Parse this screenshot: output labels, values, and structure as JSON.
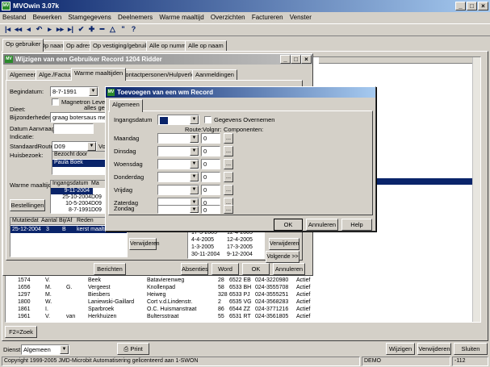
{
  "app": {
    "title": "MVOwin 3.07k"
  },
  "menu": [
    "Bestand",
    "Bewerken",
    "Stamgegevens",
    "Deelnemers",
    "Warme maaltijd",
    "Overzichten",
    "Factureren",
    "Venster"
  ],
  "toolbar_icons": [
    "first-icon",
    "prev-page-icon",
    "prev-icon",
    "undo-icon",
    "next-icon",
    "next-page-icon",
    "last-icon",
    "check-icon",
    "add-icon",
    "delete-icon",
    "up-icon",
    "quote-icon",
    "help-icon"
  ],
  "main_tabs": [
    "Op gebruiker",
    "Op naam",
    "Op adres",
    "Op vestiging/gebruiker",
    "Alle op nummer",
    "Alle op naam"
  ],
  "edit_dialog": {
    "title": "Wijzigen van een Gebruiker Record 1204 Ridder",
    "tabs": [
      "Algemeen",
      "Alge./Factuur",
      "Warme maaltijden",
      "Contactpersonen/Hulpverleners",
      "Aanmeldingen"
    ],
    "begindatum_label": "Begindatum:",
    "begindatum": "8-7-1991",
    "magnetron": "Magnetron Leveren",
    "dieet_label": "Dieet:",
    "alles_gen": "alles gen",
    "bijzonderheden_label": "Bijzonderheden:",
    "bijzonderheden": "graag botersaus met ge",
    "datum_aanvraag_label": "Datum Aanvraag:",
    "indicatie_label": "Indicatie:",
    "standaardroute_label": "StandaardRoute:",
    "standaardroute": "D09",
    "vol": "Vol",
    "huisbezoek_label": "Huisbezoek:",
    "bezocht_door": "Bezocht door",
    "bezocht_naam": "Paula Boek",
    "warme_label": "Warme maaltijd:",
    "warme_headers": [
      "Ingangsdatum",
      "Ma"
    ],
    "warme_rows": [
      [
        "9-11-2004",
        ""
      ],
      [
        "25-10-2004",
        "D09"
      ],
      [
        "10-5-2004",
        "D09"
      ],
      [
        "8-7-1991",
        "D09"
      ]
    ],
    "bestellingen": "Bestellingen",
    "mut_headers": [
      "Mutatiedat",
      "Aantal",
      "Bij/Af",
      "Reden"
    ],
    "mut_rows": [
      [
        "25-12-2004",
        "3",
        "B",
        "kerst maaltijd"
      ]
    ],
    "verwijderen": "Verwijderen",
    "right_dates": [
      [
        "17-3-2005",
        "12-4-2005"
      ],
      [
        "4-4-2005",
        "12-4-2005"
      ],
      [
        "1-3-2005",
        "17-3-2005"
      ],
      [
        "30-11-2004",
        "9-12-2004"
      ]
    ],
    "volgende": "Volgende >>",
    "berichten": "Berichten",
    "absenties": "Absenties",
    "word": "Word",
    "ok": "OK",
    "annuleren": "Annuleren"
  },
  "wm_dialog": {
    "title": "Toevoegen van een wm Record",
    "tab": "Algemeen",
    "ingangsdatum_label": "Ingangsdatum",
    "gegevens": "Gegevens Overnemen",
    "headers": [
      "Route:",
      "Volgnr:",
      "Componenten:"
    ],
    "days": [
      {
        "day": "Maandag",
        "vol": "0"
      },
      {
        "day": "Dinsdag",
        "vol": "0"
      },
      {
        "day": "Woensdag",
        "vol": "0"
      },
      {
        "day": "Donderdag",
        "vol": "0"
      },
      {
        "day": "Vrijdag",
        "vol": "0"
      },
      {
        "day": "Zaterdag",
        "vol": "0"
      },
      {
        "day": "Zondag",
        "vol": "0"
      }
    ],
    "ok": "OK",
    "annuleren": "Annuleren",
    "help": "Help"
  },
  "list_rows": [
    [
      "1574",
      "V.",
      "",
      "Beek",
      "Batavierenweg",
      "28",
      "6522 EB",
      "024-3220980",
      "Actief"
    ],
    [
      "1656",
      "M.",
      "G.",
      "Vergeest",
      "Knollenpad",
      "58",
      "6533 BH",
      "024-3555708",
      "Actief"
    ],
    [
      "1297",
      "M.",
      "",
      "Biesbers",
      "Heiweg",
      "328",
      "6533 PJ",
      "024-3555251",
      "Actief"
    ],
    [
      "1800",
      "W.",
      "",
      "Laniewski-Gaillard",
      "Cort v.d.Lindenstr.",
      "2",
      "6535 VG",
      "024-3568283",
      "Actief"
    ],
    [
      "1861",
      "I.",
      "",
      "Sparbroek",
      "O.C. Huismanstraat",
      "86",
      "6544 ZZ",
      "024-3771216",
      "Actief"
    ],
    [
      "1961",
      "V.",
      "van",
      "Herkhuizen",
      "Bultersstraat",
      "55",
      "6531 RT",
      "024-3561805",
      "Actief"
    ]
  ],
  "f2_zoek": "F2=Zoek",
  "bottom": {
    "dienst_label": "Dienst:",
    "dienst": "Algemeen",
    "print": "Print",
    "wijzigen": "Wijzigen",
    "verwijderen": "Verwijderen",
    "sluiten": "Sluiten"
  },
  "status": {
    "copyright": "Copyright 1999-2005 JMD-Microbit Automatisering gelicenteerd aan 1-SWON",
    "mode": "DEMO",
    "code": "-112"
  }
}
